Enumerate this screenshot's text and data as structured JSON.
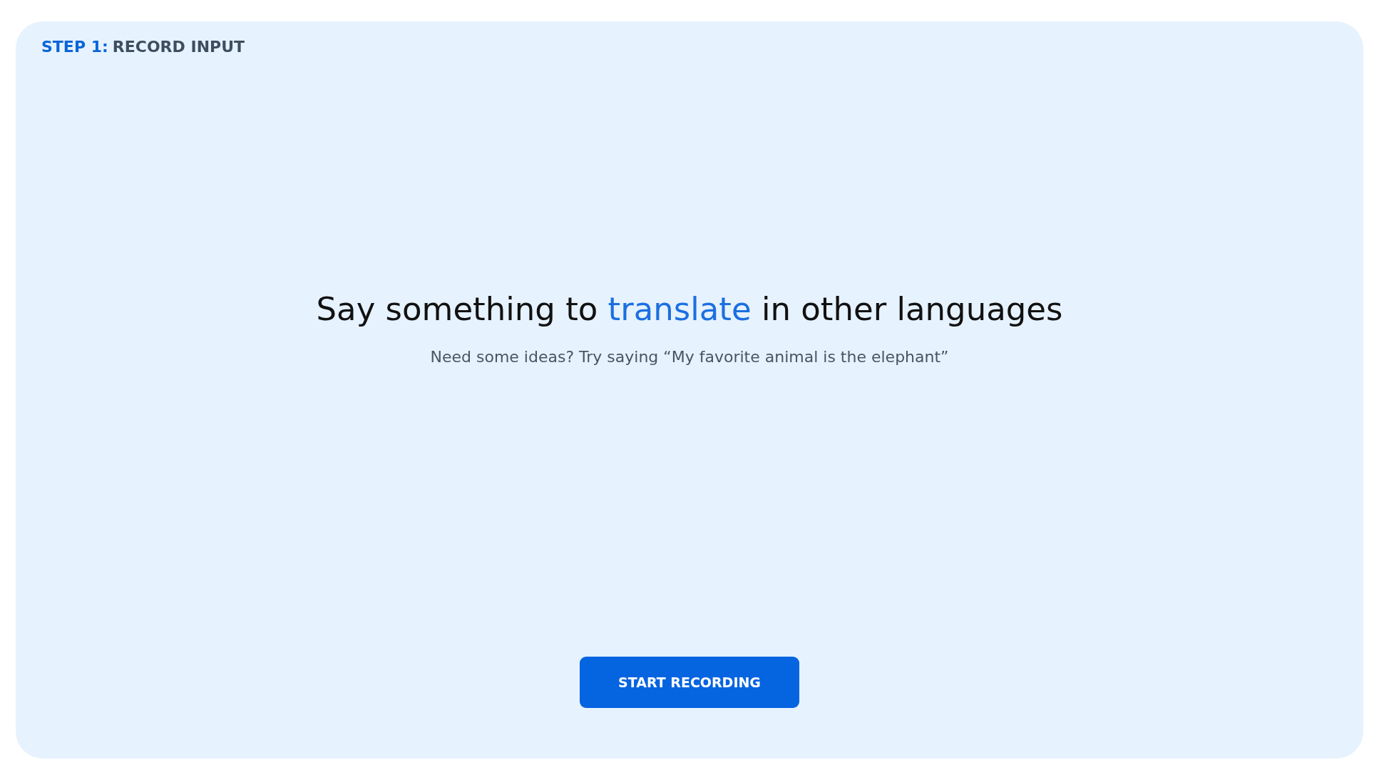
{
  "step": {
    "number": "STEP 1:",
    "title": "RECORD INPUT"
  },
  "heading": [
    {
      "text": "Say something to ",
      "accent": false
    },
    {
      "text": "translate",
      "accent": true
    },
    {
      "text": " in other languages",
      "accent": false
    }
  ],
  "hint": "Need some ideas? Try saying “My favorite animal is the elephant”",
  "button": {
    "label": "START RECORDING"
  }
}
